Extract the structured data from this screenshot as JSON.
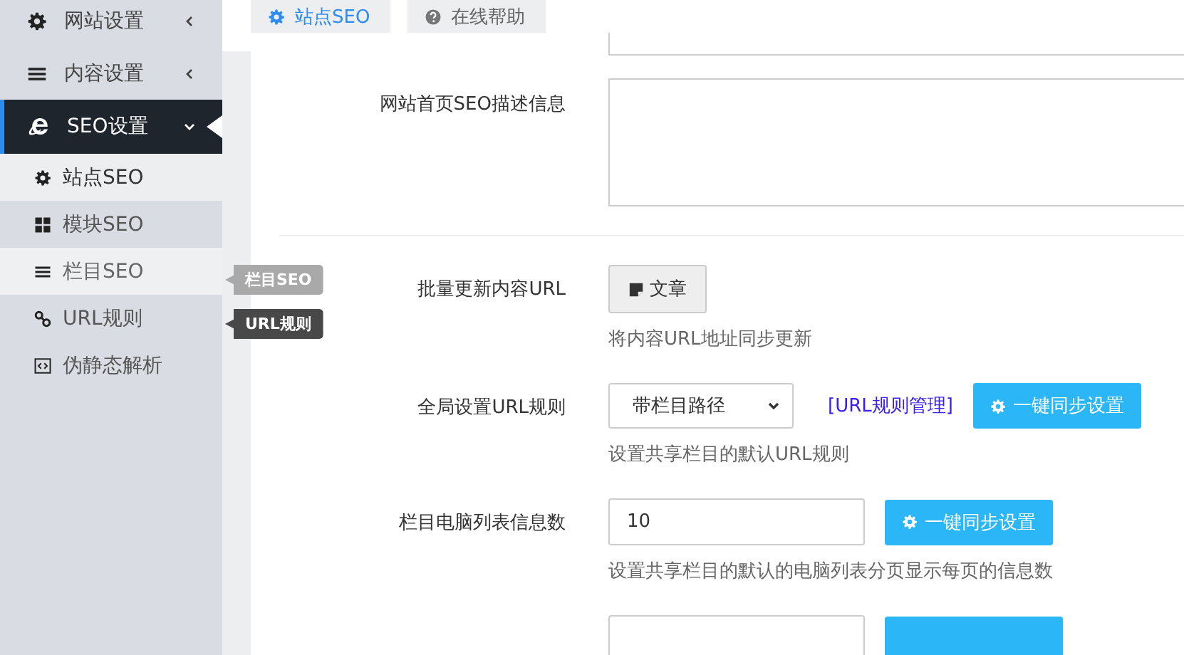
{
  "sidebar": {
    "items": [
      {
        "label": "网站设置",
        "expanded": false,
        "selected": false
      },
      {
        "label": "内容设置",
        "expanded": false,
        "selected": false
      },
      {
        "label": "SEO设置",
        "expanded": true,
        "selected": true,
        "children": [
          {
            "label": "站点SEO",
            "selected": true,
            "hovered": false
          },
          {
            "label": "模块SEO",
            "selected": false,
            "hovered": false
          },
          {
            "label": "栏目SEO",
            "selected": false,
            "hovered": true
          },
          {
            "label": "URL规则",
            "selected": false,
            "hovered": false
          },
          {
            "label": "伪静态解析",
            "selected": false,
            "hovered": false
          }
        ]
      }
    ]
  },
  "tooltips": [
    {
      "text": "栏目SEO",
      "faded": true
    },
    {
      "text": "URL规则",
      "faded": false
    }
  ],
  "tabs": [
    {
      "label": "站点SEO",
      "selected": true
    },
    {
      "label": "在线帮助",
      "selected": false
    }
  ],
  "form": {
    "rows": [
      {
        "kind": "textarea",
        "label": "网站首页SEO描述信息"
      },
      {
        "kind": "action",
        "label": "批量更新内容URL",
        "button": "文章",
        "help": "将内容URL地址同步更新"
      },
      {
        "kind": "select",
        "label": "全局设置URL规则",
        "value": "带栏目路径",
        "link": "[URL规则管理]",
        "button": "一键同步设置",
        "help": "设置共享栏目的默认URL规则"
      },
      {
        "kind": "input",
        "label": "栏目电脑列表信息数",
        "value": "10",
        "button": "一键同步设置",
        "help": "设置共享栏目的默认的电脑列表分页显示每页的信息数"
      },
      {
        "kind": "input_cut"
      }
    ]
  }
}
